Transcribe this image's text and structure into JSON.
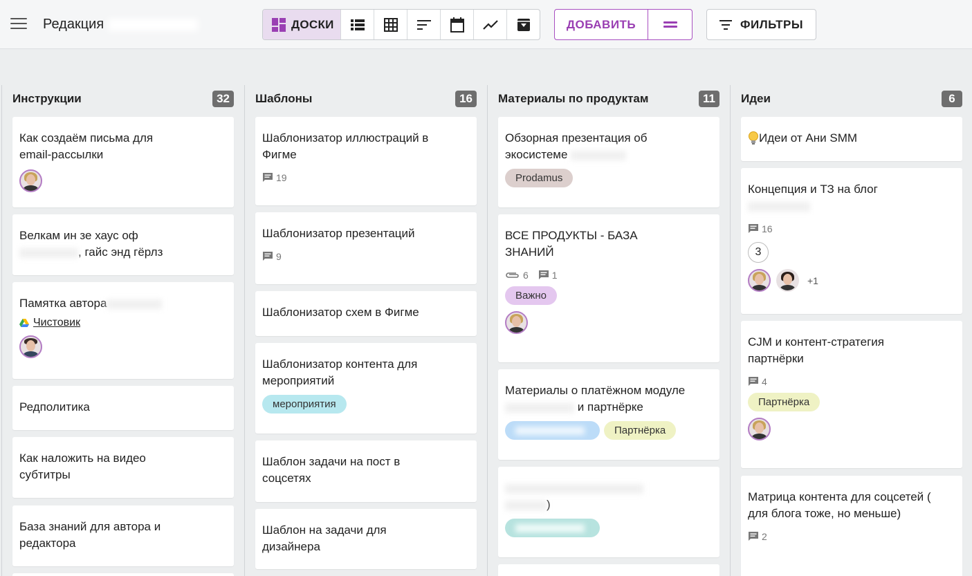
{
  "header": {
    "title": "Редакция",
    "views": [
      {
        "name": "boards",
        "label": "ДОСКИ",
        "active": true
      },
      {
        "name": "list",
        "label": ""
      },
      {
        "name": "table",
        "label": ""
      },
      {
        "name": "gantt",
        "label": ""
      },
      {
        "name": "calendar",
        "label": ""
      },
      {
        "name": "chart",
        "label": ""
      },
      {
        "name": "archive",
        "label": ""
      }
    ],
    "add_label": "ДОБАВИТЬ",
    "filter_label": "ФИЛЬТРЫ"
  },
  "columns": [
    {
      "title": "Инструкции",
      "count": "32",
      "cards": [
        {
          "title": "Как создаём письма для email-рассылки"
        },
        {
          "title_a": "Велкам ин зе хаус оф",
          "title_b": ", гайс энд гёрлз"
        },
        {
          "title": "Памятка автора",
          "link": "Чистовик"
        },
        {
          "title": "Редполитика"
        },
        {
          "title": "Как наложить на видео субтитры"
        },
        {
          "title": "База знаний для автора и редактора"
        }
      ]
    },
    {
      "title": "Шаблоны",
      "count": "16",
      "cards": [
        {
          "title": "Шаблонизатор иллюстраций в Фигме",
          "comments": "19"
        },
        {
          "title": "Шаблонизатор презентаций",
          "comments": "9"
        },
        {
          "title": "Шаблонизатор схем в Фигме"
        },
        {
          "title": "Шаблонизатор контента для мероприятий",
          "tag": "мероприятия"
        },
        {
          "title": "Шаблон задачи на пост в соцсетях"
        },
        {
          "title": "Шаблон на задачи для дизайнера"
        }
      ]
    },
    {
      "title": "Материалы по продуктам",
      "count": "11",
      "cards": [
        {
          "title": "Обзорная презентация об экосистеме",
          "tag": "Prodamus"
        },
        {
          "title": "ВСЕ ПРОДУКТЫ - БАЗА ЗНАНИЙ",
          "attachments": "6",
          "comments": "1",
          "tag": "Важно"
        },
        {
          "title_a": "Материалы о платёжном модуле",
          "title_b": "и партнёрке",
          "tag2": "Партнёрка"
        },
        {
          "title_b": ")"
        }
      ]
    },
    {
      "title": "Идеи",
      "count": "6",
      "cards": [
        {
          "title": "Идеи от Ани SMM"
        },
        {
          "title": "Концепция и ТЗ на блог",
          "comments": "16",
          "checklist": "3",
          "more_avatars": "+1"
        },
        {
          "title": "CJM и контент-стратегия партнёрки",
          "comments": "4",
          "tag": "Партнёрка"
        },
        {
          "title": "Матрица контента для соцсетей ( для блога тоже, но меньше)",
          "comments": "2"
        }
      ]
    }
  ],
  "colors": {
    "accent": "#9a3fb3",
    "tag_prodamus": "#dccfcd",
    "tag_important": "#e4c7ef",
    "tag_events": "#b7e8ef",
    "tag_partner": "#eff2c4",
    "tag_pay": "#bcdcf8",
    "tag_smarts": "#b7e3df"
  }
}
